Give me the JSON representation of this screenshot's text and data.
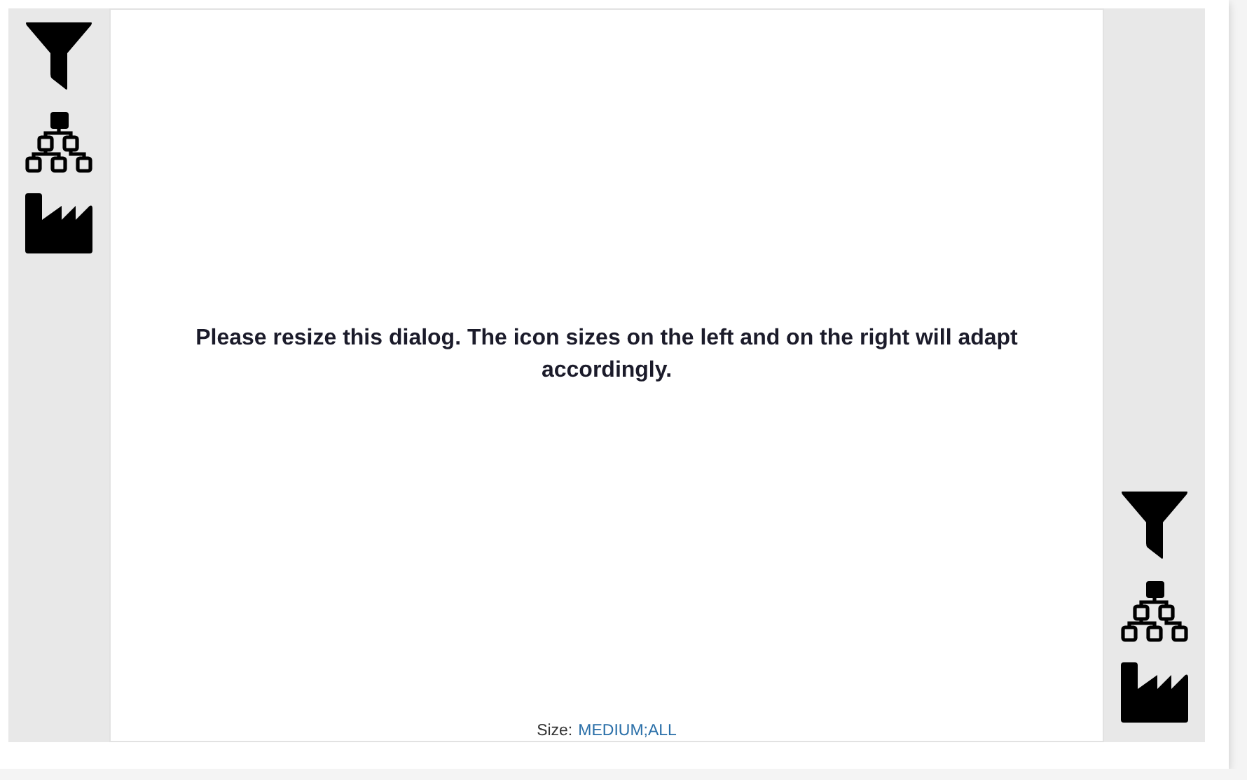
{
  "message": "Please resize this dialog. The icon sizes on the left and on the right will adapt accordingly.",
  "status": {
    "label": "Size:",
    "value": "MEDIUM;ALL"
  }
}
